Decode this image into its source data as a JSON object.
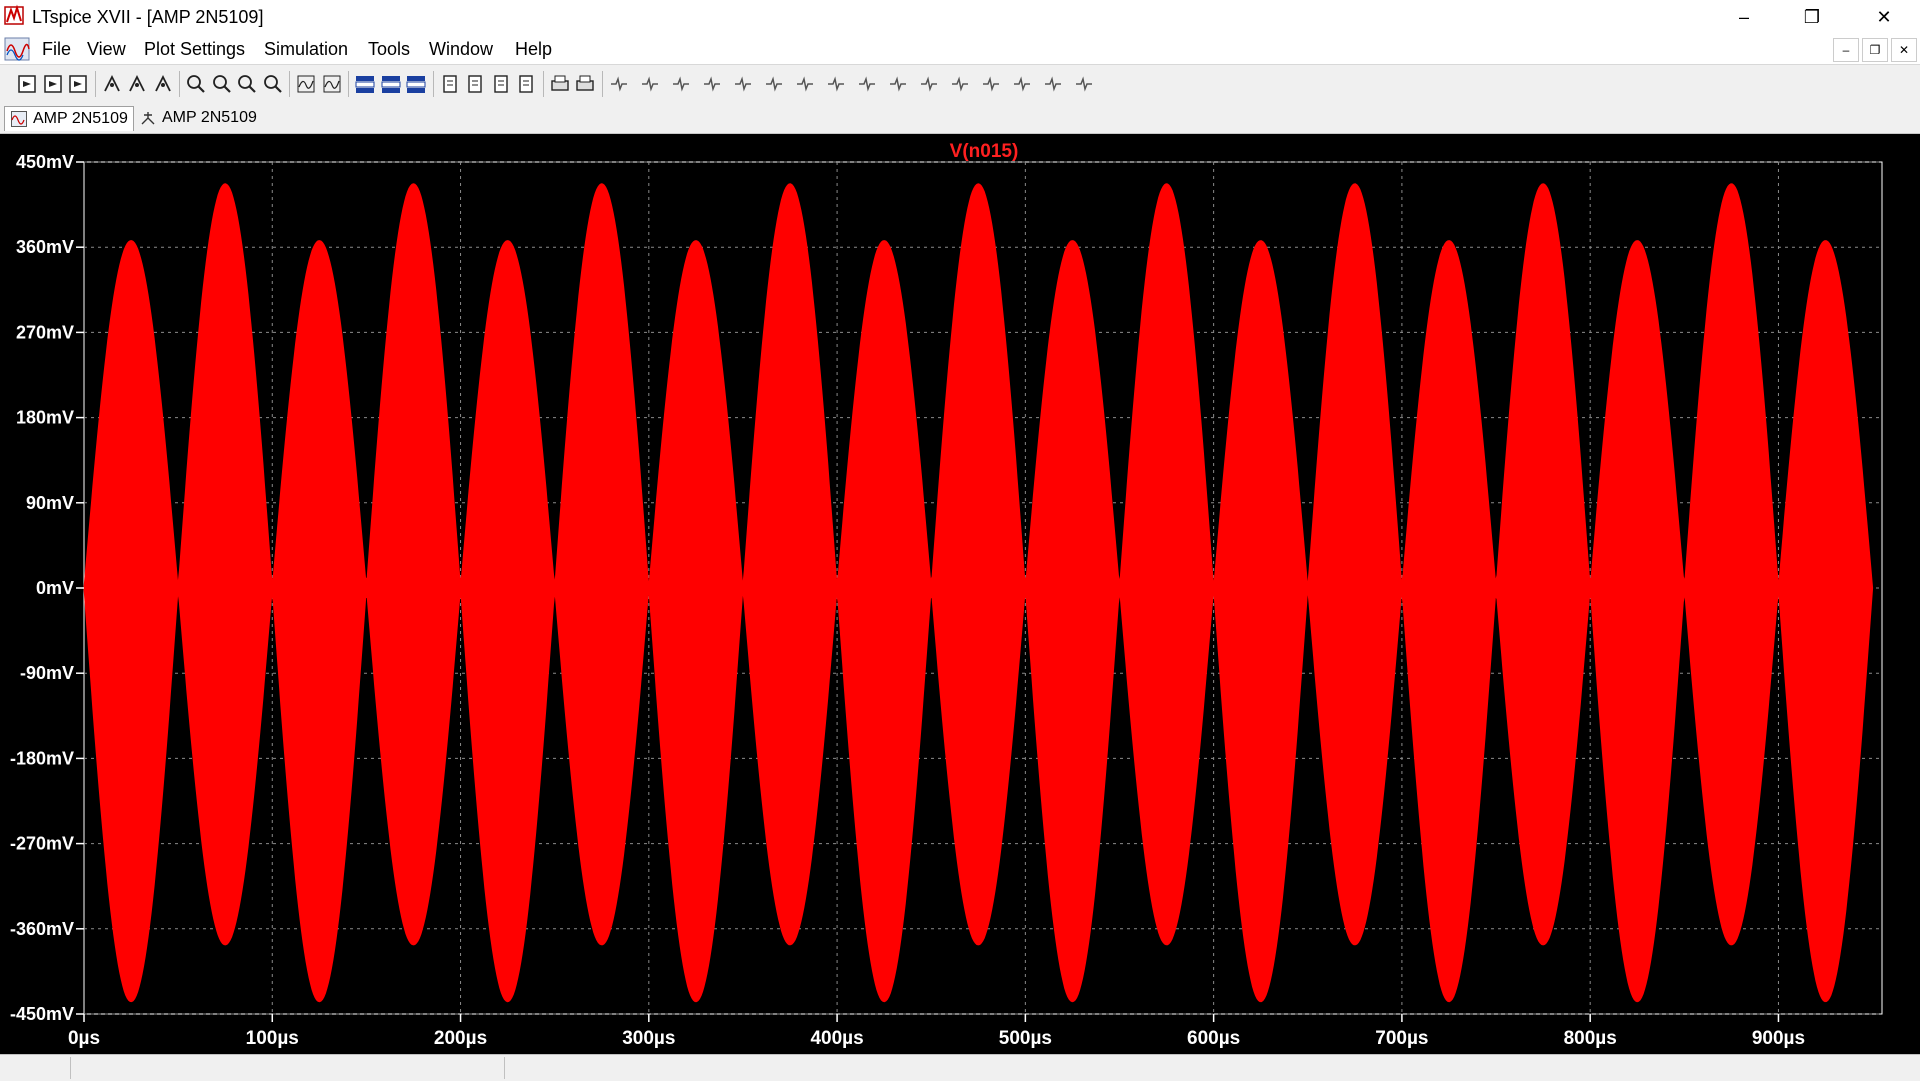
{
  "window": {
    "title": "LTspice XVII - [AMP 2N5109]",
    "minimize_glyph": "–",
    "restore_glyph": "❐",
    "close_glyph": "✕"
  },
  "menu": {
    "items": [
      {
        "label": "File"
      },
      {
        "label": "View"
      },
      {
        "label": "Plot Settings"
      },
      {
        "label": "Simulation"
      },
      {
        "label": "Tools"
      },
      {
        "label": "Window"
      },
      {
        "label": "Help"
      }
    ],
    "mdi_minimize": "–",
    "mdi_restore": "❐",
    "mdi_close": "✕"
  },
  "toolbar": {
    "icons": [
      "new-icon",
      "open-icon",
      "save-icon",
      "control-panel-icon",
      "run-icon",
      "halt-icon",
      "zoom-in-icon",
      "zoom-out-icon",
      "zoom-fit-icon",
      "zoom-cancel-icon",
      "autorange-icon",
      "grid-icon",
      "tile-horizontal-icon",
      "cascade-icon",
      "tile-vertical-icon",
      "cut-icon",
      "copy-icon",
      "paste-icon",
      "find-icon",
      "print-icon",
      "print-setup-icon",
      "draw-wire-icon",
      "ground-icon",
      "label-net-icon",
      "resistor-icon",
      "capacitor-icon",
      "inductor-icon",
      "diode-icon",
      "component-icon",
      "move-icon",
      "drag-icon",
      "undo-icon",
      "redo-icon",
      "rotate-icon",
      "mirror-icon",
      "text-icon",
      "spice-directive-icon"
    ]
  },
  "tabs": [
    {
      "label": "AMP 2N5109",
      "icon": "waveform-icon",
      "active": true
    },
    {
      "label": "AMP 2N5109",
      "icon": "schematic-icon",
      "active": false
    }
  ],
  "colors": {
    "trace": "#ff0000",
    "plot_bg": "#000000",
    "axis_text": "#ffffff",
    "grid": "#8a8a8a",
    "trace_label": "#ff2020"
  },
  "chart_data": {
    "type": "line",
    "title": "V(n015)",
    "xlabel": "",
    "ylabel": "",
    "x_unit": "µs",
    "y_unit": "mV",
    "xlim": [
      0,
      955
    ],
    "ylim": [
      -450,
      450
    ],
    "x_ticks": [
      "0µs",
      "100µs",
      "200µs",
      "300µs",
      "400µs",
      "500µs",
      "600µs",
      "700µs",
      "800µs",
      "900µs"
    ],
    "x_tick_values": [
      0,
      100,
      200,
      300,
      400,
      500,
      600,
      700,
      800,
      900
    ],
    "y_ticks": [
      "450mV",
      "360mV",
      "270mV",
      "180mV",
      "90mV",
      "0mV",
      "-90mV",
      "-180mV",
      "-270mV",
      "-360mV",
      "-450mV"
    ],
    "y_tick_values": [
      450,
      360,
      270,
      180,
      90,
      0,
      -90,
      -180,
      -270,
      -360,
      -450
    ],
    "grid": true,
    "series": [
      {
        "name": "V(n015)",
        "description_points_us": [
          0,
          25,
          50,
          75,
          100,
          125,
          150,
          175,
          200,
          225,
          250,
          275,
          300,
          325,
          350,
          375,
          400,
          425,
          450,
          475,
          500,
          525,
          550,
          575,
          600,
          625,
          650,
          675,
          700,
          725,
          750,
          775,
          800,
          825,
          850,
          875,
          900,
          925,
          950
        ],
        "upper_envelope_mV": [
          0,
          367,
          0,
          427,
          0,
          367,
          0,
          427,
          0,
          367,
          0,
          427,
          0,
          367,
          0,
          427,
          0,
          367,
          0,
          427,
          0,
          367,
          0,
          427,
          0,
          367,
          0,
          427,
          0,
          367,
          0,
          427,
          0,
          367,
          0,
          427,
          0,
          367,
          0
        ],
        "lower_envelope_mV": [
          0,
          -437,
          0,
          -377,
          0,
          -437,
          0,
          -377,
          0,
          -437,
          0,
          -377,
          0,
          -437,
          0,
          -377,
          0,
          -437,
          0,
          -377,
          0,
          -437,
          0,
          -377,
          0,
          -437,
          0,
          -377,
          0,
          -437,
          0,
          -377,
          0,
          -437,
          0,
          -377,
          0,
          -437,
          0
        ]
      }
    ]
  }
}
